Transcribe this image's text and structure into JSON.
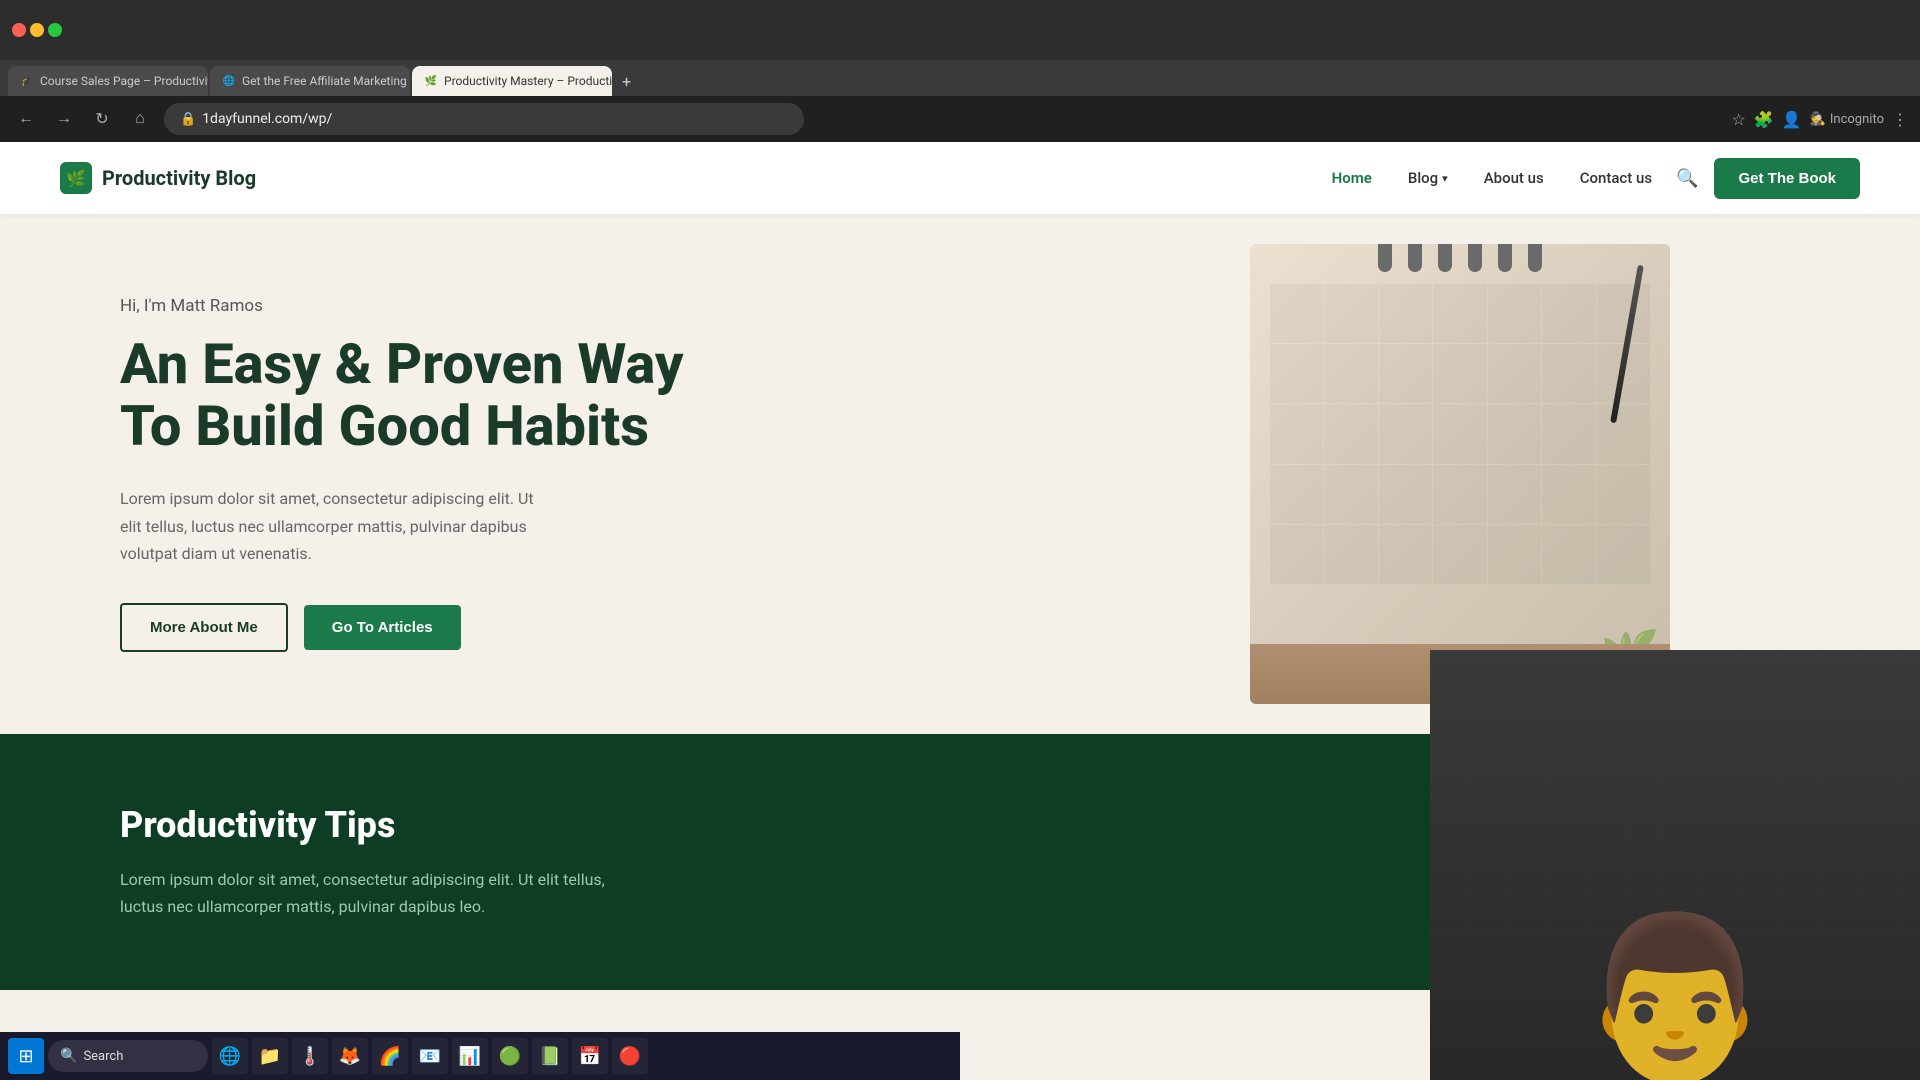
{
  "browser": {
    "tabs": [
      {
        "id": "tab1",
        "title": "Course Sales Page – Productivit...",
        "favicon": "🎓",
        "active": false
      },
      {
        "id": "tab2",
        "title": "Get the Free Affiliate Marketing",
        "favicon": "🌐",
        "active": false
      },
      {
        "id": "tab3",
        "title": "Productivity Mastery – Productivit...",
        "favicon": "🌿",
        "active": true
      }
    ],
    "address": "1dayfunnel.com/wp/",
    "incognito_label": "Incognito"
  },
  "navbar": {
    "logo_icon": "🌿",
    "logo_text": "Productivity Blog",
    "nav_links": [
      {
        "label": "Home",
        "active": true
      },
      {
        "label": "Blog",
        "has_dropdown": true,
        "active": false
      },
      {
        "label": "About us",
        "active": false
      },
      {
        "label": "Contact us",
        "active": false
      }
    ],
    "cta_label": "Get The Book"
  },
  "hero": {
    "greeting": "Hi, I'm Matt Ramos",
    "title_line1": "An Easy & Proven Way",
    "title_line2": "To Build Good Habits",
    "body_text": "Lorem ipsum dolor sit amet, consectetur adipiscing elit. Ut elit tellus, luctus nec ullamcorper mattis, pulvinar dapibus volutpat diam ut venenatis.",
    "btn_about": "More About Me",
    "btn_articles": "Go To Articles"
  },
  "section_dark": {
    "title": "Productivity Tips",
    "body": "Lorem ipsum dolor sit amet, consectetur adipiscing elit. Ut elit tellus, luctus nec ullamcorper mattis, pulvinar dapibus leo."
  },
  "taskbar": {
    "search_label": "Search",
    "apps": [
      "🌐",
      "📁",
      "🌡️",
      "🦊",
      "🌈",
      "📧",
      "📊",
      "🟢",
      "📗",
      "📅",
      "🔴"
    ]
  }
}
